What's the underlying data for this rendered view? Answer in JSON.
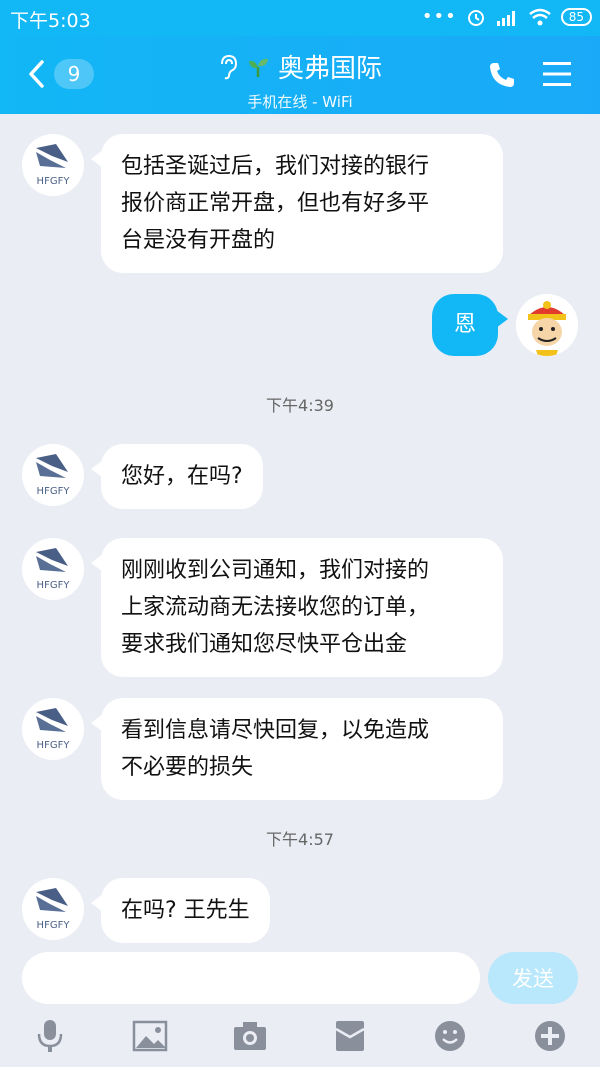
{
  "status_bar": {
    "time": "下午5:03",
    "battery": "85",
    "icons": [
      "dots-icon",
      "alarm-icon",
      "hd-signal-icon",
      "wifi-icon",
      "battery-icon"
    ]
  },
  "header": {
    "back_count": "9",
    "title": "奥弗国际",
    "subtitle": "手机在线 - WiFi",
    "accent": "#12b7f5"
  },
  "messages": [
    {
      "type": "received",
      "avatar": "HFGFY",
      "lines": [
        "包括圣诞过后，我们对接的银行",
        "报价商正常开盘，但也有好多平",
        "台是没有开盘的"
      ]
    },
    {
      "type": "sent",
      "text": "恩"
    },
    {
      "type": "time",
      "text": "下午4:39"
    },
    {
      "type": "received",
      "avatar": "HFGFY",
      "lines": [
        "您好，在吗?"
      ]
    },
    {
      "type": "received",
      "avatar": "HFGFY",
      "lines": [
        "刚刚收到公司通知，我们对接的",
        "上家流动商无法接收您的订单，",
        "要求我们通知您尽快平仓出金"
      ]
    },
    {
      "type": "received",
      "avatar": "HFGFY",
      "lines": [
        "看到信息请尽快回复，以免造成",
        "不必要的损失"
      ]
    },
    {
      "type": "time",
      "text": "下午4:57"
    },
    {
      "type": "received",
      "avatar": "HFGFY",
      "lines": [
        "在吗? 王先生"
      ]
    }
  ],
  "input": {
    "value": "",
    "send_label": "发送"
  },
  "toolbar": [
    "microphone-icon",
    "image-icon",
    "camera-icon",
    "red-packet-icon",
    "emoji-icon",
    "plus-icon"
  ]
}
